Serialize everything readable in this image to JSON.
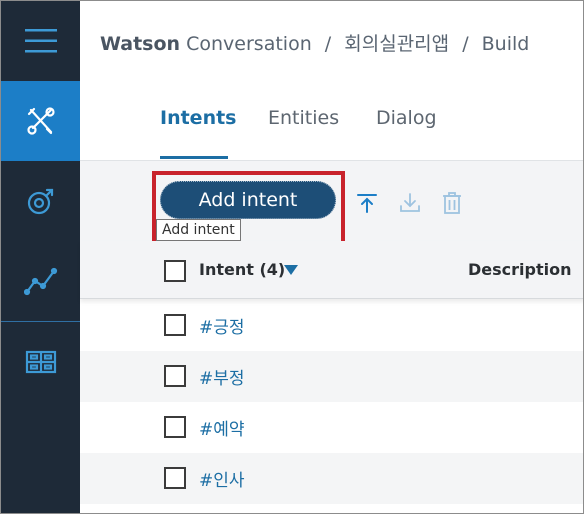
{
  "breadcrumb": {
    "brand": "Watson",
    "product": "Conversation",
    "separator": "/",
    "workspace": "회의실관리앱",
    "section": "Build"
  },
  "sidebar": {
    "items": [
      {
        "icon": "menu-icon",
        "active": false
      },
      {
        "icon": "tools-icon",
        "active": true
      },
      {
        "icon": "improve-icon",
        "active": false
      },
      {
        "icon": "analytics-icon",
        "active": false
      },
      {
        "icon": "deploy-icon",
        "active": false
      }
    ]
  },
  "tabs": [
    {
      "label": "Intents",
      "active": true
    },
    {
      "label": "Entities",
      "active": false
    },
    {
      "label": "Dialog",
      "active": false
    }
  ],
  "toolbar": {
    "add_label": "Add intent",
    "tooltip": "Add intent",
    "icons": [
      "upload-icon",
      "download-icon",
      "trash-icon"
    ]
  },
  "table": {
    "intent_header": "Intent (4)",
    "description_header": "Description",
    "rows": [
      {
        "name": "#긍정"
      },
      {
        "name": "#부정"
      },
      {
        "name": "#예약"
      },
      {
        "name": "#인사"
      }
    ]
  },
  "colors": {
    "rail": "#1e2a38",
    "rail_active": "#1c7ec7",
    "accent": "#1c6ea4",
    "button": "#1d4e77",
    "highlight": "#c8232c"
  }
}
